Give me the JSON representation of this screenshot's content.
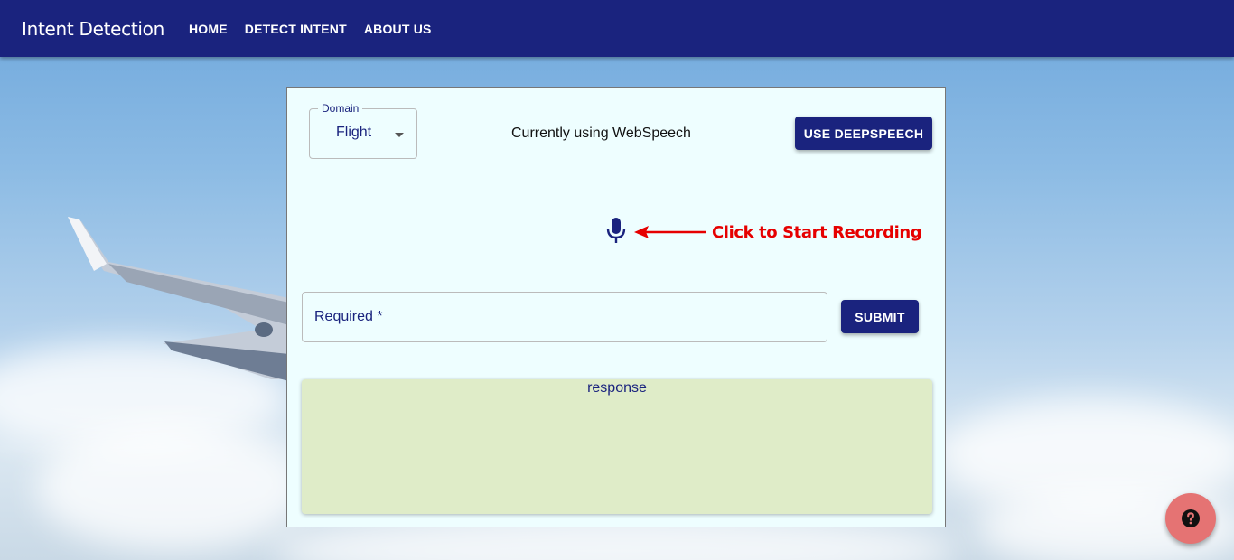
{
  "app": {
    "title": "Intent Detection"
  },
  "nav": {
    "items": [
      {
        "label": "HOME"
      },
      {
        "label": "DETECT INTENT"
      },
      {
        "label": "ABOUT US"
      }
    ]
  },
  "form": {
    "domain": {
      "label": "Domain",
      "selected": "Flight"
    },
    "speech_status": "Currently using WebSpeech",
    "switch_engine_label": "USE DEEPSPEECH",
    "record_hint": "Click to Start Recording",
    "query_input": {
      "value": "",
      "placeholder": "Required *"
    },
    "submit_label": "SUBMIT",
    "response_label": "response"
  },
  "icons": {
    "mic": "microphone-icon",
    "arrow": "arrow-left-icon",
    "help": "question-circle-icon",
    "dropdown": "caret-down-icon"
  },
  "colors": {
    "primary": "#1a237e",
    "card_background": "#eefeff",
    "response_background": "#dfecc8",
    "hint_red": "#e60000",
    "help_fab": "#e57373"
  }
}
